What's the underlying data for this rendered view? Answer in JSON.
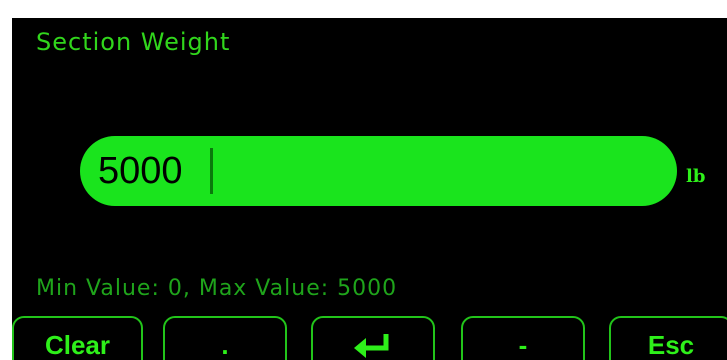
{
  "title": "Section Weight",
  "input": {
    "value": "5000",
    "unit": "lb"
  },
  "range_text": "Min Value: 0, Max Value: 5000",
  "keys": {
    "clear": "Clear",
    "dot": ".",
    "enter_icon": "enter-arrow",
    "minus": "-",
    "esc": "Esc"
  },
  "colors": {
    "background": "#000000",
    "accent": "#1ae41d",
    "text_green": "#2ef01a"
  }
}
